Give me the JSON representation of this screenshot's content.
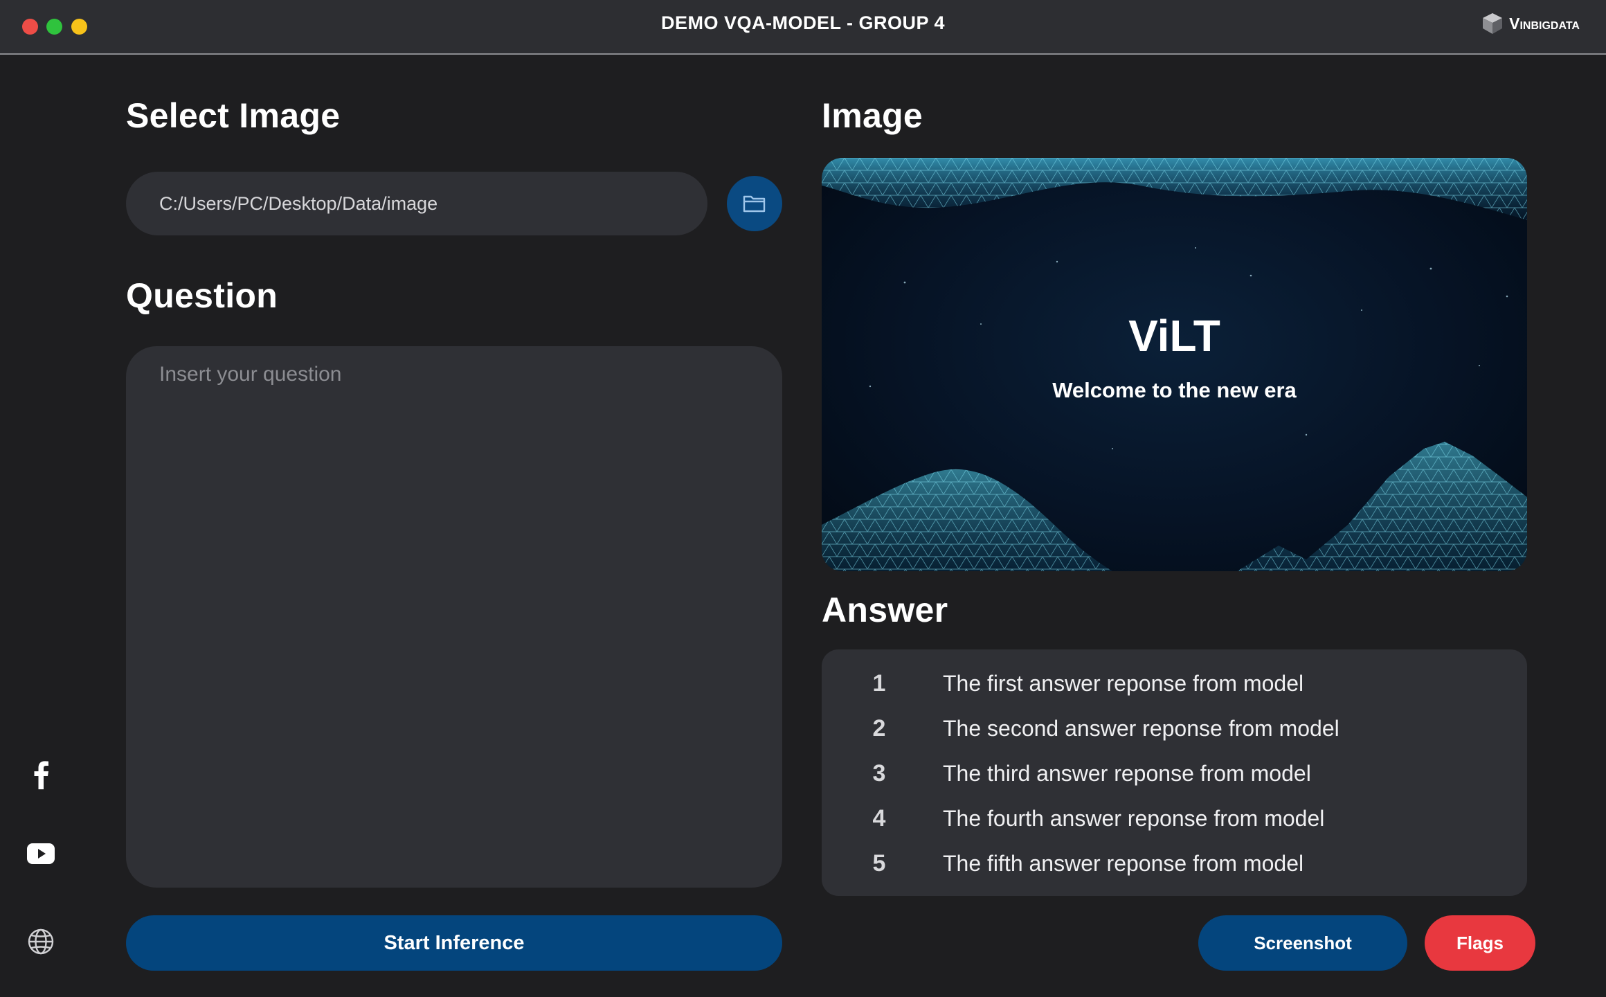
{
  "window": {
    "title": "DEMO VQA-MODEL - GROUP 4",
    "brand": "Vinbigdata"
  },
  "sidebar": {
    "icons": [
      "facebook-icon",
      "youtube-icon",
      "globe-icon"
    ]
  },
  "select_image": {
    "heading": "Select Image",
    "path_value": "C:/Users/PC/Desktop/Data/image",
    "folder_icon": "folder-icon"
  },
  "question": {
    "heading": "Question",
    "placeholder": "Insert your question"
  },
  "image": {
    "heading": "Image",
    "title": "ViLT",
    "subtitle": "Welcome to the new era"
  },
  "answer": {
    "heading": "Answer",
    "items": [
      {
        "num": "1",
        "text": "The first answer reponse from model"
      },
      {
        "num": "2",
        "text": "The second answer reponse from model"
      },
      {
        "num": "3",
        "text": "The third answer reponse from model"
      },
      {
        "num": "4",
        "text": "The fourth answer reponse from model"
      },
      {
        "num": "5",
        "text": "The fifth answer reponse from model"
      }
    ]
  },
  "buttons": {
    "start": "Start Inference",
    "screenshot": "Screenshot",
    "flags": "Flags"
  },
  "colors": {
    "background": "#1e1e20",
    "panel": "#2f3035",
    "primary_button": "#04457d",
    "flags_button": "#e8383f",
    "titlebar": "#2d2e32"
  }
}
